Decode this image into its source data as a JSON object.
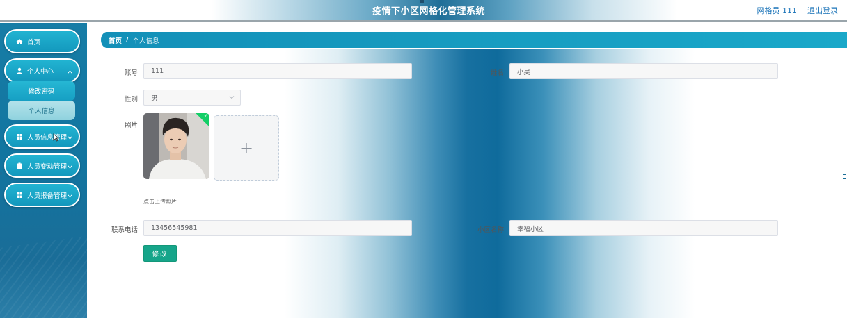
{
  "header": {
    "title": "疫情下小区网格化管理系统",
    "user_label": "网格员 111",
    "logout_label": "退出登录"
  },
  "sidebar": {
    "items": [
      {
        "label": "首页",
        "icon": "home-icon"
      },
      {
        "label": "个人中心",
        "icon": "user-icon",
        "expanded": true,
        "children": [
          {
            "label": "修改密码"
          },
          {
            "label": "个人信息",
            "active": true
          }
        ]
      },
      {
        "label": "人员信息管理",
        "icon": "grid-icon"
      },
      {
        "label": "人员变动管理",
        "icon": "clipboard-icon"
      },
      {
        "label": "人员报备管理",
        "icon": "grid-icon"
      }
    ]
  },
  "breadcrumb": {
    "home": "首页",
    "separator": "/",
    "current": "个人信息"
  },
  "form": {
    "account_label": "账号",
    "account_value": "111",
    "name_label": "姓名",
    "name_value": "小吴",
    "gender_label": "性别",
    "gender_value": "男",
    "photo_label": "照片",
    "upload_hint": "点击上传照片",
    "phone_label": "联系电话",
    "phone_value": "13456545981",
    "community_label": "小区名称",
    "community_value": "幸福小区",
    "submit_label": "修改"
  },
  "colors": {
    "sidebar": "#1275a0",
    "pill": "#1aa8c9",
    "submit": "#16a58a",
    "upload_success": "#13ce66"
  }
}
